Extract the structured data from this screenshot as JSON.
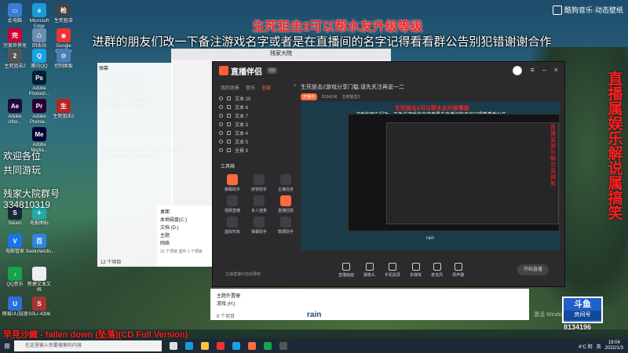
{
  "overlay": {
    "title_red": "生死狙击2可以帮水友升级等级",
    "title_white": "进群的朋友们改一下备注游戏名字或者是在直播间的名字记得看看群公告别犯错谢谢合作",
    "welcome": "欢迎各位",
    "play_together": "共同游玩",
    "group_label": "残家大院群号",
    "group_number": "334810319",
    "right_vertical": "直播属娱乐解说属搞笑",
    "brand": "酷狗音乐·动态壁纸",
    "song": "早見沙織 - fallen down (坠落)(CD Full Version)"
  },
  "desktop_icons": [
    {
      "label": "此电脑",
      "color": "#3a7bd5",
      "glyph": "▭"
    },
    {
      "label": "Microsoft Edge",
      "color": "#1b9ad6",
      "glyph": "e"
    },
    {
      "label": "生死狙击",
      "color": "#444",
      "glyph": "枪"
    },
    {
      "label": "完美世界竞技平台",
      "color": "#c03",
      "glyph": "完"
    },
    {
      "label": "回收站",
      "color": "#6a8fb0",
      "glyph": "♺"
    },
    {
      "label": "Google Chrome",
      "color": "#e33",
      "glyph": "◉"
    },
    {
      "label": "生死狙击2",
      "color": "#555",
      "glyph": "2"
    },
    {
      "label": "腾讯QQ",
      "color": "#1aa1e6",
      "glyph": "Q"
    },
    {
      "label": "控制面板",
      "color": "#4a7fb7",
      "glyph": "⚙"
    },
    {
      "label": "Adobe Photosh...",
      "color": "#001e36",
      "glyph": "Ps"
    },
    {
      "label": "Adobe After...",
      "color": "#1f0a3a",
      "glyph": "Ae"
    },
    {
      "label": "Adobe Premie...",
      "color": "#2a0033",
      "glyph": "Pr"
    },
    {
      "label": "生死狙击2",
      "color": "#b22",
      "glyph": "生"
    },
    {
      "label": "Adobe Media...",
      "color": "#003",
      "glyph": "Me"
    },
    {
      "label": "Steam",
      "color": "#1b2838",
      "glyph": "S"
    },
    {
      "label": "电报图标",
      "color": "#2aa",
      "glyph": "✈"
    },
    {
      "label": "电脑管家",
      "color": "#1a73e8",
      "glyph": "V"
    },
    {
      "label": "BaiduNetdis...",
      "color": "#2e86de",
      "glyph": "百"
    },
    {
      "label": "QQ音乐",
      "color": "#16a34a",
      "glyph": "♪"
    },
    {
      "label": "新建文本文档",
      "color": "#eee",
      "glyph": "≡"
    },
    {
      "label": "网易UU加速",
      "color": "#2b6fdb",
      "glyph": "U"
    },
    {
      "label": "SSLI-4396",
      "color": "#a33",
      "glyph": "S"
    }
  ],
  "back_window": {
    "title": "残家大院",
    "help_lines": [
      "欢迎使用斗鱼弹幕助手",
      "左侧按钮可调整设置",
      "互动区域可放大或缩小",
      "右上角可设置透明度",
      "在设置中可进行弹幕设置",
      "添加弹幕助手至场景"
    ],
    "help_lines2": [
      "这里展示收到的礼物、消息、贡献列表",
      "在这里可设置个礼物屏蔽"
    ]
  },
  "white_panel": {
    "header": "弹幕",
    "footer": "12 个项目"
  },
  "explorer": {
    "items": [
      "桌面",
      "本地磁盘(C:)",
      "文档 (D:)",
      "主题",
      "网络"
    ],
    "footer_left": "12 个项目",
    "footer_right": "选中 1 个项目"
  },
  "bottom_explorer": {
    "items": [
      "主题外置硬",
      "游戏 (H:)"
    ],
    "footer": "8 个项目",
    "rain": "rain"
  },
  "app": {
    "name": "直播伴侣",
    "version": "3.0",
    "tabs": [
      "我的场景",
      "音乐",
      "全部"
    ],
    "active_tab": "全部",
    "scenes": [
      "文本 20",
      "文本 6",
      "文本 7",
      "文本 3",
      "文本 4",
      "文本 5",
      "全景 9"
    ],
    "tools_title": "工具箱",
    "tools": [
      {
        "label": "弹幕助手",
        "hot": true
      },
      {
        "label": "房管助手",
        "hot": false
      },
      {
        "label": "主播任务",
        "hot": false
      },
      {
        "label": "视频直播",
        "hot": false
      },
      {
        "label": "多人连麦",
        "hot": false
      },
      {
        "label": "直播回放",
        "hot": true
      },
      {
        "label": "虚拟形象",
        "hot": false
      },
      {
        "label": "弹幕助手",
        "hot": false
      },
      {
        "label": "数据助手",
        "hot": false
      }
    ],
    "bottom_hint": "主播直播中自动录制",
    "stream_title": "生死狙击2游戏分享门槛:请先关注再说一二",
    "stream_meta": {
      "status": "开播中",
      "id": "8134196",
      "category": "生死狙击2"
    },
    "preview": {
      "title_red": "生死狙击2可以帮水友升级等级",
      "title_white": "进群的朋友们改一下备注游戏名字或者是在直播间的名字记得看看群公告",
      "rain": "rain",
      "vertical": "直播属娱乐解说属搞笑"
    },
    "controls": [
      "直播画面",
      "摄像头",
      "手机投屏",
      "多媒体",
      "麦克风",
      "扬声器"
    ],
    "start_button": "开始直播"
  },
  "douyu": {
    "name": "斗鱼",
    "sub": "房间号",
    "room": "8134196"
  },
  "watermark": "激活 Windows",
  "taskbar": {
    "search_placeholder": "在这里输入你要搜索的内容",
    "weather": "4°C 阴",
    "lang": "英",
    "time": "19:04",
    "date": "2022/1/3"
  }
}
